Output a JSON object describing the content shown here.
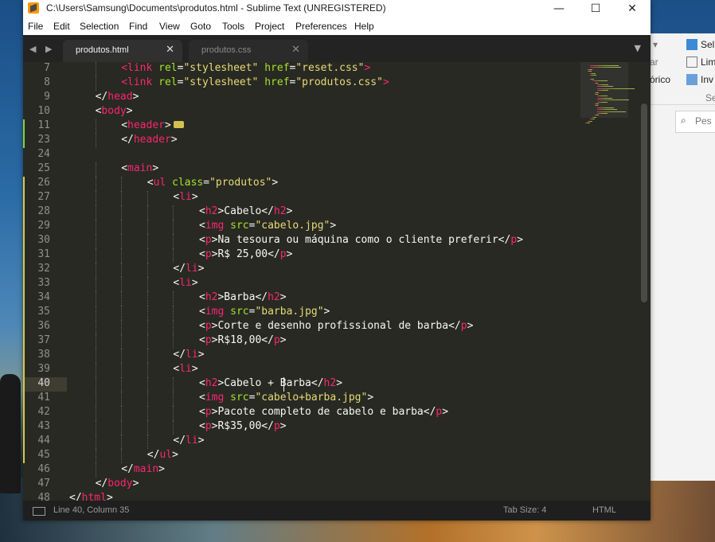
{
  "window": {
    "title": "C:\\Users\\Samsung\\Documents\\produtos.html - Sublime Text (UNREGISTERED)",
    "minimize": "—",
    "maximize": "☐",
    "close": "✕"
  },
  "menu": [
    "File",
    "Edit",
    "Selection",
    "Find",
    "View",
    "Goto",
    "Tools",
    "Project",
    "Preferences",
    "Help"
  ],
  "tabs": [
    {
      "label": "produtos.html",
      "active": true
    },
    {
      "label": "produtos.css",
      "active": false
    }
  ],
  "tab_nav": "◀ ▶",
  "tab_close": "✕",
  "tab_dropdown": "▼",
  "lines": [
    {
      "n": "7",
      "indent": 2,
      "tokens": [
        [
          "tag",
          "<link"
        ],
        [
          "text",
          " "
        ],
        [
          "attr",
          "rel"
        ],
        [
          "text",
          "="
        ],
        [
          "str",
          "\"stylesheet\""
        ],
        [
          "text",
          " "
        ],
        [
          "attr",
          "href"
        ],
        [
          "text",
          "="
        ],
        [
          "str",
          "\"reset.css\""
        ],
        [
          "tag",
          ">"
        ]
      ]
    },
    {
      "n": "8",
      "indent": 2,
      "tokens": [
        [
          "tag",
          "<link"
        ],
        [
          "text",
          " "
        ],
        [
          "attr",
          "rel"
        ],
        [
          "text",
          "="
        ],
        [
          "str",
          "\"stylesheet\""
        ],
        [
          "text",
          " "
        ],
        [
          "attr",
          "href"
        ],
        [
          "text",
          "="
        ],
        [
          "str",
          "\"produtos.css\""
        ],
        [
          "tag",
          ">"
        ]
      ]
    },
    {
      "n": "9",
      "indent": 1,
      "tokens": [
        [
          "text",
          "</"
        ],
        [
          "tag",
          "head"
        ],
        [
          "text",
          ">"
        ]
      ]
    },
    {
      "n": "10",
      "indent": 1,
      "tokens": [
        [
          "text",
          "<"
        ],
        [
          "tag",
          "body"
        ],
        [
          "text",
          ">"
        ]
      ]
    },
    {
      "n": "11",
      "indent": 2,
      "tokens": [
        [
          "text",
          "<"
        ],
        [
          "tag",
          "header"
        ],
        [
          "text",
          ">"
        ],
        [
          "fold",
          ""
        ]
      ],
      "mod": "green"
    },
    {
      "n": "23",
      "indent": 2,
      "tokens": [
        [
          "text",
          "</"
        ],
        [
          "tag",
          "header"
        ],
        [
          "text",
          ">"
        ]
      ],
      "mod": "green"
    },
    {
      "n": "24",
      "indent": 0,
      "tokens": []
    },
    {
      "n": "25",
      "indent": 2,
      "tokens": [
        [
          "text",
          "<"
        ],
        [
          "tag",
          "main"
        ],
        [
          "text",
          ">"
        ]
      ]
    },
    {
      "n": "26",
      "indent": 3,
      "tokens": [
        [
          "text",
          "<"
        ],
        [
          "tag",
          "ul"
        ],
        [
          "text",
          " "
        ],
        [
          "attr",
          "class"
        ],
        [
          "text",
          "="
        ],
        [
          "str",
          "\"produtos\""
        ],
        [
          "text",
          ">"
        ]
      ],
      "mod": "yellow"
    },
    {
      "n": "27",
      "indent": 4,
      "tokens": [
        [
          "text",
          "<"
        ],
        [
          "tag",
          "li"
        ],
        [
          "text",
          ">"
        ]
      ],
      "mod": "yellow"
    },
    {
      "n": "28",
      "indent": 5,
      "tokens": [
        [
          "text",
          "<"
        ],
        [
          "tag",
          "h2"
        ],
        [
          "text",
          ">Cabelo</"
        ],
        [
          "tag",
          "h2"
        ],
        [
          "text",
          ">"
        ]
      ],
      "mod": "yellow"
    },
    {
      "n": "29",
      "indent": 5,
      "tokens": [
        [
          "text",
          "<"
        ],
        [
          "tag",
          "img"
        ],
        [
          "text",
          " "
        ],
        [
          "attr",
          "src"
        ],
        [
          "text",
          "="
        ],
        [
          "str",
          "\"cabelo.jpg\""
        ],
        [
          "text",
          ">"
        ]
      ],
      "mod": "yellow"
    },
    {
      "n": "30",
      "indent": 5,
      "tokens": [
        [
          "text",
          "<"
        ],
        [
          "tag",
          "p"
        ],
        [
          "text",
          ">Na tesoura ou máquina como o cliente preferir</"
        ],
        [
          "tag",
          "p"
        ],
        [
          "text",
          ">"
        ]
      ],
      "mod": "yellow"
    },
    {
      "n": "31",
      "indent": 5,
      "tokens": [
        [
          "text",
          "<"
        ],
        [
          "tag",
          "p"
        ],
        [
          "text",
          ">R$ 25,00</"
        ],
        [
          "tag",
          "p"
        ],
        [
          "text",
          ">"
        ]
      ],
      "mod": "yellow"
    },
    {
      "n": "32",
      "indent": 4,
      "tokens": [
        [
          "text",
          "</"
        ],
        [
          "tag",
          "li"
        ],
        [
          "text",
          ">"
        ]
      ],
      "mod": "yellow"
    },
    {
      "n": "33",
      "indent": 4,
      "tokens": [
        [
          "text",
          "<"
        ],
        [
          "tag",
          "li"
        ],
        [
          "text",
          ">"
        ]
      ],
      "mod": "yellow"
    },
    {
      "n": "34",
      "indent": 5,
      "tokens": [
        [
          "text",
          "<"
        ],
        [
          "tag",
          "h2"
        ],
        [
          "text",
          ">Barba</"
        ],
        [
          "tag",
          "h2"
        ],
        [
          "text",
          ">"
        ]
      ],
      "mod": "yellow"
    },
    {
      "n": "35",
      "indent": 5,
      "tokens": [
        [
          "text",
          "<"
        ],
        [
          "tag",
          "img"
        ],
        [
          "text",
          " "
        ],
        [
          "attr",
          "src"
        ],
        [
          "text",
          "="
        ],
        [
          "str",
          "\"barba.jpg\""
        ],
        [
          "text",
          ">"
        ]
      ],
      "mod": "yellow"
    },
    {
      "n": "36",
      "indent": 5,
      "tokens": [
        [
          "text",
          "<"
        ],
        [
          "tag",
          "p"
        ],
        [
          "text",
          ">Corte e desenho profissional de barba</"
        ],
        [
          "tag",
          "p"
        ],
        [
          "text",
          ">"
        ]
      ],
      "mod": "yellow"
    },
    {
      "n": "37",
      "indent": 5,
      "tokens": [
        [
          "text",
          "<"
        ],
        [
          "tag",
          "p"
        ],
        [
          "text",
          ">R$18,00</"
        ],
        [
          "tag",
          "p"
        ],
        [
          "text",
          ">"
        ]
      ],
      "mod": "yellow"
    },
    {
      "n": "38",
      "indent": 4,
      "tokens": [
        [
          "text",
          "</"
        ],
        [
          "tag",
          "li"
        ],
        [
          "text",
          ">"
        ]
      ],
      "mod": "yellow"
    },
    {
      "n": "39",
      "indent": 4,
      "tokens": [
        [
          "text",
          "<"
        ],
        [
          "tag",
          "li"
        ],
        [
          "text",
          ">"
        ]
      ],
      "mod": "yellow"
    },
    {
      "n": "40",
      "indent": 5,
      "tokens": [
        [
          "text",
          "<"
        ],
        [
          "tag",
          "h2"
        ],
        [
          "text",
          ">Cabelo + Barba</"
        ],
        [
          "tag",
          "h2"
        ],
        [
          "text",
          ">"
        ]
      ],
      "mod": "yellow",
      "current": true
    },
    {
      "n": "41",
      "indent": 5,
      "tokens": [
        [
          "text",
          "<"
        ],
        [
          "tag",
          "img"
        ],
        [
          "text",
          " "
        ],
        [
          "attr",
          "src"
        ],
        [
          "text",
          "="
        ],
        [
          "str",
          "\"cabelo+barba.jpg\""
        ],
        [
          "text",
          ">"
        ]
      ],
      "mod": "yellow"
    },
    {
      "n": "42",
      "indent": 5,
      "tokens": [
        [
          "text",
          "<"
        ],
        [
          "tag",
          "p"
        ],
        [
          "text",
          ">Pacote completo de cabelo e barba</"
        ],
        [
          "tag",
          "p"
        ],
        [
          "text",
          ">"
        ]
      ],
      "mod": "yellow"
    },
    {
      "n": "43",
      "indent": 5,
      "tokens": [
        [
          "text",
          "<"
        ],
        [
          "tag",
          "p"
        ],
        [
          "text",
          ">R$35,00</"
        ],
        [
          "tag",
          "p"
        ],
        [
          "text",
          ">"
        ]
      ],
      "mod": "yellow"
    },
    {
      "n": "44",
      "indent": 4,
      "tokens": [
        [
          "text",
          "</"
        ],
        [
          "tag",
          "li"
        ],
        [
          "text",
          ">"
        ]
      ],
      "mod": "yellow"
    },
    {
      "n": "45",
      "indent": 3,
      "tokens": [
        [
          "text",
          "</"
        ],
        [
          "tag",
          "ul"
        ],
        [
          "text",
          ">"
        ]
      ],
      "mod": "yellow"
    },
    {
      "n": "46",
      "indent": 2,
      "tokens": [
        [
          "text",
          "</"
        ],
        [
          "tag",
          "main"
        ],
        [
          "text",
          ">"
        ]
      ]
    },
    {
      "n": "47",
      "indent": 1,
      "tokens": [
        [
          "text",
          "</"
        ],
        [
          "tag",
          "body"
        ],
        [
          "text",
          ">"
        ]
      ]
    },
    {
      "n": "48",
      "indent": 0,
      "tokens": [
        [
          "text",
          "</"
        ],
        [
          "tag",
          "html"
        ],
        [
          "text",
          ">"
        ]
      ]
    }
  ],
  "status": {
    "position": "Line 40, Column 35",
    "tab_size": "Tab Size: 4",
    "syntax": "HTML"
  },
  "explorer": {
    "ribbon": [
      "ir ▾",
      "car",
      "córico"
    ],
    "ribbon_right": [
      "Sel",
      "Lim",
      "Inv"
    ],
    "group_label": "Se",
    "search_placeholder": "Pes"
  },
  "colors": {
    "editor_bg": "#282923",
    "tag": "#f92672",
    "attr": "#a6e22e",
    "string": "#e6db74",
    "mod_green": "#8ccf3a",
    "mod_yellow": "#d7c84a"
  }
}
